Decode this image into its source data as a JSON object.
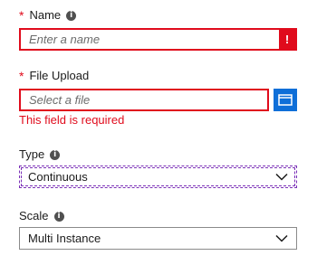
{
  "name_field": {
    "label": "Name",
    "required_marker": "*",
    "info_icon": "info-icon",
    "placeholder": "Enter a name",
    "error_flag": "!"
  },
  "file_upload_field": {
    "label": "File Upload",
    "required_marker": "*",
    "placeholder": "Select a file",
    "browse_icon": "folder-icon",
    "error_message": "This field is required"
  },
  "type_field": {
    "label": "Type",
    "info_icon": "info-icon",
    "selected": "Continuous"
  },
  "scale_field": {
    "label": "Scale",
    "info_icon": "info-icon",
    "selected": "Multi Instance"
  },
  "colors": {
    "error": "#e00b1c",
    "accent": "#0f6fd8",
    "focus": "#7a2fb7"
  }
}
